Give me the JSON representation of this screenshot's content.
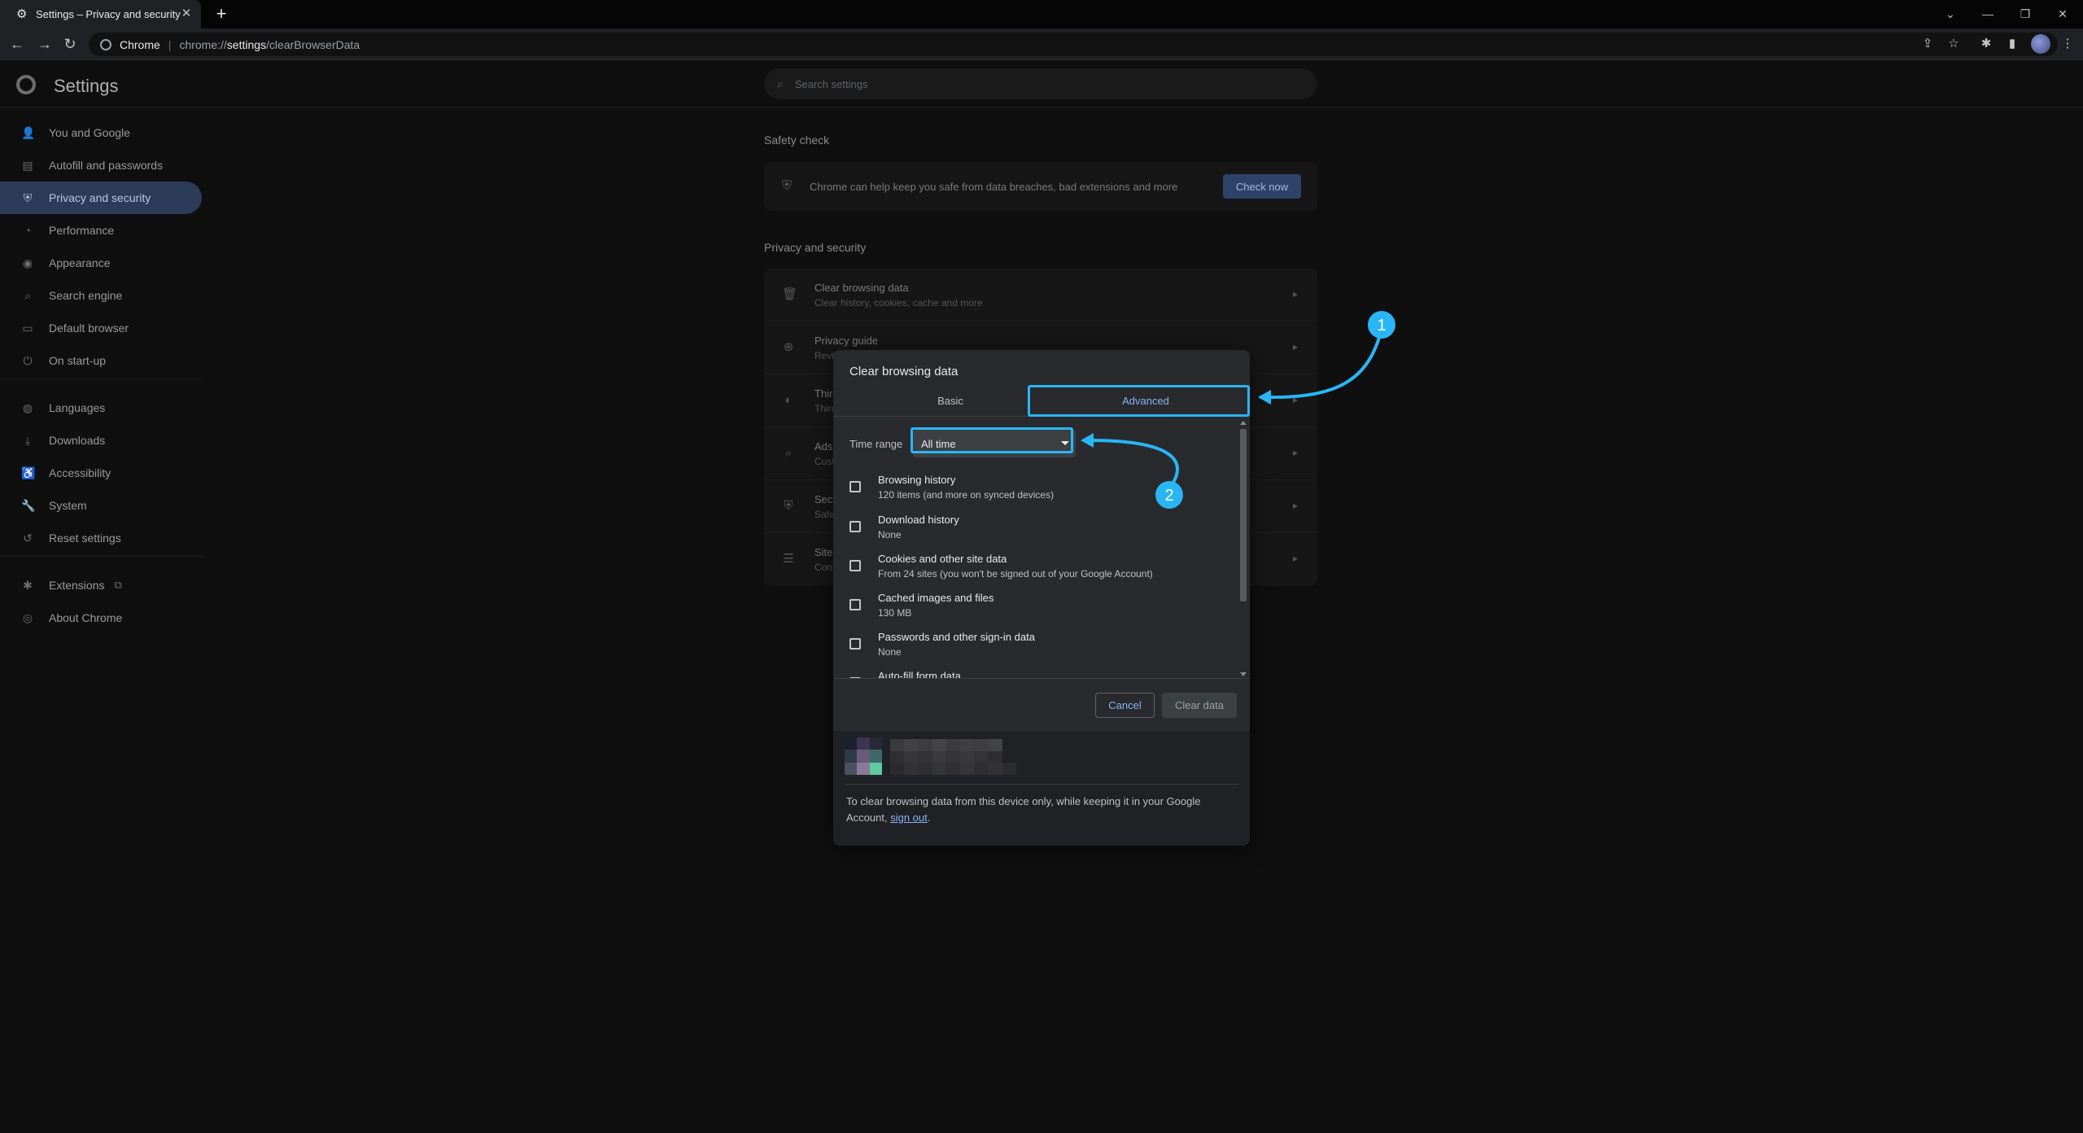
{
  "browser": {
    "tab_title": "Settings – Privacy and security",
    "new_tab": "+",
    "omnibox_site": "Chrome",
    "omnibox_url_host": "chrome://",
    "omnibox_url_path": "settings",
    "omnibox_url_rest": "/clearBrowserData"
  },
  "settings": {
    "title": "Settings",
    "search_placeholder": "Search settings"
  },
  "sidebar": {
    "items": [
      {
        "label": "You and Google",
        "icon": "person-icon"
      },
      {
        "label": "Autofill and passwords",
        "icon": "clipboard-icon"
      },
      {
        "label": "Privacy and security",
        "icon": "shield-icon",
        "active": true
      },
      {
        "label": "Performance",
        "icon": "speedometer-icon"
      },
      {
        "label": "Appearance",
        "icon": "palette-icon"
      },
      {
        "label": "Search engine",
        "icon": "search-icon"
      },
      {
        "label": "Default browser",
        "icon": "browser-window-icon"
      },
      {
        "label": "On start-up",
        "icon": "power-icon"
      }
    ],
    "items2": [
      {
        "label": "Languages",
        "icon": "globe-icon"
      },
      {
        "label": "Downloads",
        "icon": "download-icon"
      },
      {
        "label": "Accessibility",
        "icon": "accessibility-icon"
      },
      {
        "label": "System",
        "icon": "wrench-icon"
      },
      {
        "label": "Reset settings",
        "icon": "reset-icon"
      }
    ],
    "items3": [
      {
        "label": "Extensions",
        "icon": "puzzle-icon"
      },
      {
        "label": "About Chrome",
        "icon": "chrome-icon"
      }
    ]
  },
  "safety_check": {
    "heading": "Safety check",
    "text": "Chrome can help keep you safe from data breaches, bad extensions and more",
    "button": "Check now"
  },
  "privacy": {
    "heading": "Privacy and security",
    "rows": [
      {
        "title": "Clear browsing data",
        "sub": "Clear history, cookies, cache and more"
      },
      {
        "title": "Privacy guide",
        "sub": "Revie"
      },
      {
        "title": "Third",
        "sub": "Third"
      },
      {
        "title": "Ads p",
        "sub": "Cust"
      },
      {
        "title": "Secu",
        "sub": "Safe"
      },
      {
        "title": "Site s",
        "sub": "Cont"
      }
    ]
  },
  "dialog": {
    "title": "Clear browsing data",
    "tab_basic": "Basic",
    "tab_advanced": "Advanced",
    "time_range_label": "Time range",
    "time_range_value": "All time",
    "options": [
      {
        "title": "Browsing history",
        "sub": "120 items (and more on synced devices)"
      },
      {
        "title": "Download history",
        "sub": "None"
      },
      {
        "title": "Cookies and other site data",
        "sub": "From 24 sites (you won't be signed out of your Google Account)"
      },
      {
        "title": "Cached images and files",
        "sub": "130 MB"
      },
      {
        "title": "Passwords and other sign-in data",
        "sub": "None"
      },
      {
        "title": "Auto-fill form data",
        "sub": ""
      }
    ],
    "cancel": "Cancel",
    "clear": "Clear data",
    "footer_text": "To clear browsing data from this device only, while keeping it in your Google Account, ",
    "footer_link": "sign out",
    "footer_end": "."
  },
  "annotations": {
    "marker1": "1",
    "marker2": "2",
    "color": "#29b6f6"
  }
}
